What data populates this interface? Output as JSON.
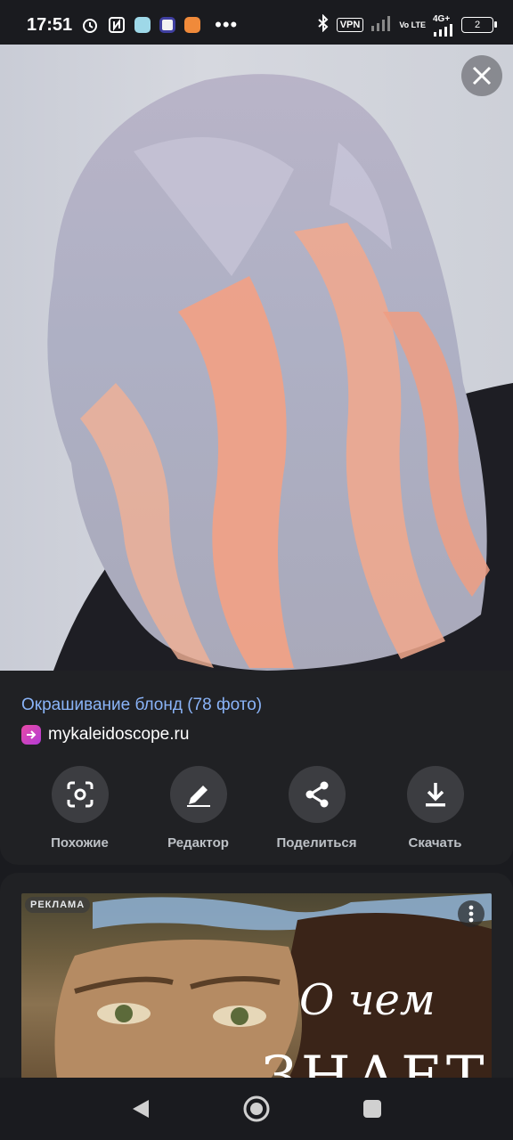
{
  "status_bar": {
    "time": "17:51",
    "vpn": "VPN",
    "network": "4G+",
    "lte": "Vo LTE",
    "battery": "2",
    "more": "•••"
  },
  "image": {
    "description_icons": [
      "close-icon"
    ]
  },
  "result": {
    "title": "Окрашивание блонд (78 фото)",
    "source": "mykaleidoscope.ru",
    "title_color": "#8ab4f8"
  },
  "actions": [
    {
      "label": "Похожие",
      "icon": "lens-icon"
    },
    {
      "label": "Редактор",
      "icon": "pencil-icon"
    },
    {
      "label": "Поделиться",
      "icon": "share-icon"
    },
    {
      "label": "Скачать",
      "icon": "download-icon"
    }
  ],
  "ad": {
    "badge": "РЕКЛАМА",
    "line1": "О чем",
    "line2": "ЗНАЕТ"
  },
  "nav": {
    "icons": [
      "back-icon",
      "home-icon",
      "recents-icon"
    ]
  }
}
